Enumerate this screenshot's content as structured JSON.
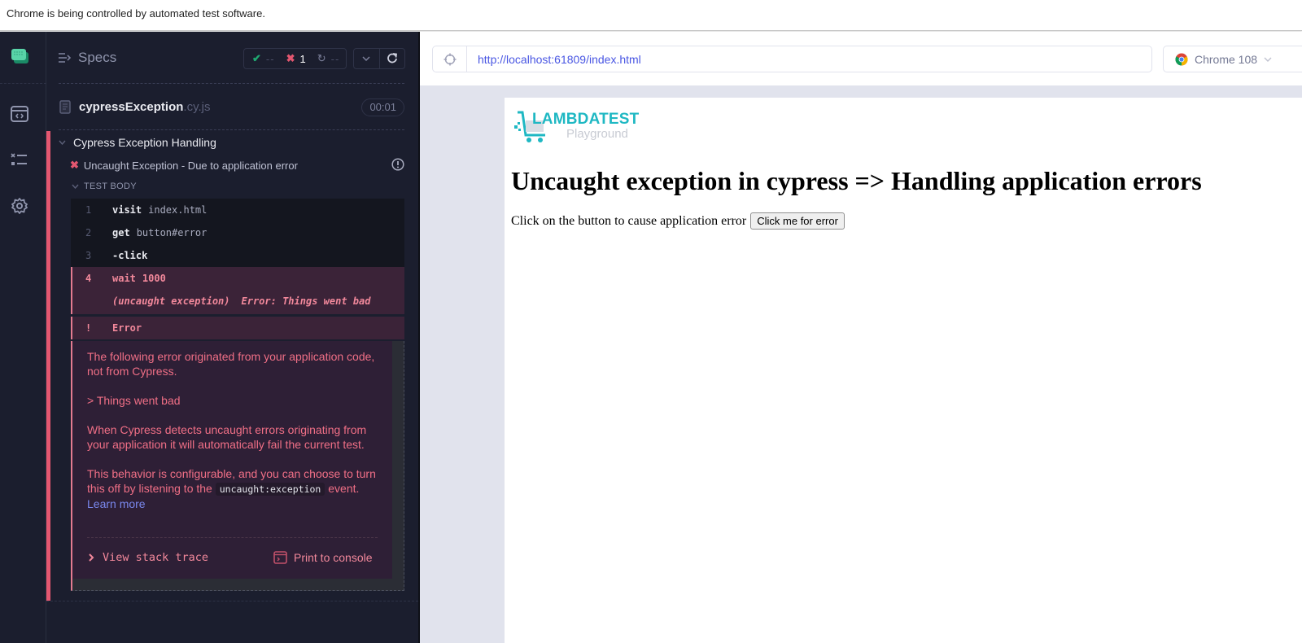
{
  "infobar": {
    "text": "Chrome is being controlled by automated test software."
  },
  "nav": {
    "items": [
      {
        "icon": "cypress-logo-icon"
      },
      {
        "icon": "specs-list-icon"
      },
      {
        "icon": "runs-icon"
      },
      {
        "icon": "settings-icon"
      }
    ]
  },
  "reporter": {
    "specs_label": "Specs",
    "stats": {
      "passed": "--",
      "failed": "1",
      "pending": "--"
    },
    "spec": {
      "name": "cypressException",
      "ext": ".cy.js",
      "duration": "00:01"
    },
    "suite": {
      "title": "Cypress Exception Handling"
    },
    "test": {
      "title": "Uncaught Exception - Due to application error",
      "status": "failed"
    },
    "test_body_label": "TEST BODY",
    "commands": [
      {
        "num": "1",
        "name": "visit",
        "arg": "index.html"
      },
      {
        "num": "2",
        "name": "get",
        "arg": "button#error"
      },
      {
        "num": "3",
        "name": "-click",
        "arg": ""
      },
      {
        "num": "4",
        "name": "wait",
        "arg": "1000"
      },
      {
        "num": "",
        "name": "(uncaught exception)",
        "arg": "Error: Things went bad"
      },
      {
        "num": "!",
        "name": "Error",
        "arg": ""
      }
    ],
    "error": {
      "p1": "The following error originated from your application code, not from Cypress.",
      "p2": "> Things went bad",
      "p3": "When Cypress detects uncaught errors originating from your application it will automatically fail the current test.",
      "p4_before": "This behavior is configurable, and you can choose to turn this off by listening to the",
      "p4_code": "uncaught:exception",
      "p4_after": "event.",
      "learn_more": "Learn more",
      "view_stack": "View stack trace",
      "print_console": "Print to console"
    }
  },
  "aut": {
    "url": "http://localhost:61809/index.html",
    "browser": "Chrome 108",
    "page": {
      "logo_top": "LAMBDATEST",
      "logo_bottom": "Playground",
      "heading": "Uncaught exception in cypress => Handling application errors",
      "prompt": "Click on the button to cause application error",
      "button": "Click me for error"
    }
  },
  "colors": {
    "fail": "#e45770",
    "pass": "#1fa971",
    "link": "#4956e3",
    "brand": "#1fb8c3"
  }
}
